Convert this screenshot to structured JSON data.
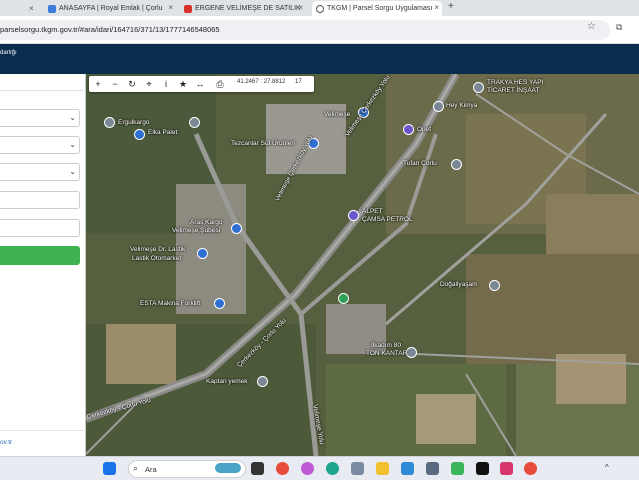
{
  "browser": {
    "tabs": [
      {
        "label": "ANASAYFA | Royal Emlak | Çorlu",
        "color": "#3b7cd9"
      },
      {
        "label": "ERGENE VELİMEŞE DE SATILIK",
        "color": "#d8322b"
      },
      {
        "label": "TKGM | Parsel Sorgu Uygulaması",
        "color": "#555555",
        "active": true
      }
    ],
    "url": "parselsorgu.tkgm.gov.tr/#ara/idari/164716/371/13/1777146548065"
  },
  "header": {
    "title": "darlığı"
  },
  "sidebar": {
    "footer_link": "ov.tr"
  },
  "toolbar": {
    "coords": "41.2467 : 27.8812",
    "zoom": "17"
  },
  "map_labels": [
    {
      "text": "Ergulkargo"
    },
    {
      "text": "Elka Palet"
    },
    {
      "text": "Tezcanlar Süt Ürünleri"
    },
    {
      "text": "Velimeşe"
    },
    {
      "text": "Velimeşe Çerkezköy Yolu"
    },
    {
      "text": "Opet"
    },
    {
      "text": "Tufan Çorlu"
    },
    {
      "text": "Hey Kimya"
    },
    {
      "text": "TRAKYA HES YAPI"
    },
    {
      "text": "TİCARET İNŞAAT"
    },
    {
      "text": "ALPET"
    },
    {
      "text": "ÇAMSA PETROL"
    },
    {
      "text": "Aras Kargo"
    },
    {
      "text": "Velimeşe Şubesi"
    },
    {
      "text": "Velimeşe Dr. Lastik"
    },
    {
      "text": "Lastik Otomarket"
    },
    {
      "text": "ESTA Makina Forklift"
    },
    {
      "text": "Çerkezköy - Çorlu Yolu"
    },
    {
      "text": "Doğallyaşam"
    },
    {
      "text": "İlkadım 80"
    },
    {
      "text": "TON KANTAR"
    },
    {
      "text": "Kaptan yemek"
    },
    {
      "text": "Çerkezköy - Çorlu Yolu"
    },
    {
      "text": "Velimeşe Yolu"
    },
    {
      "text": "Velimeşe Çerkezköy Yolu"
    }
  ],
  "taskbar": {
    "search_placeholder": "Ara"
  }
}
